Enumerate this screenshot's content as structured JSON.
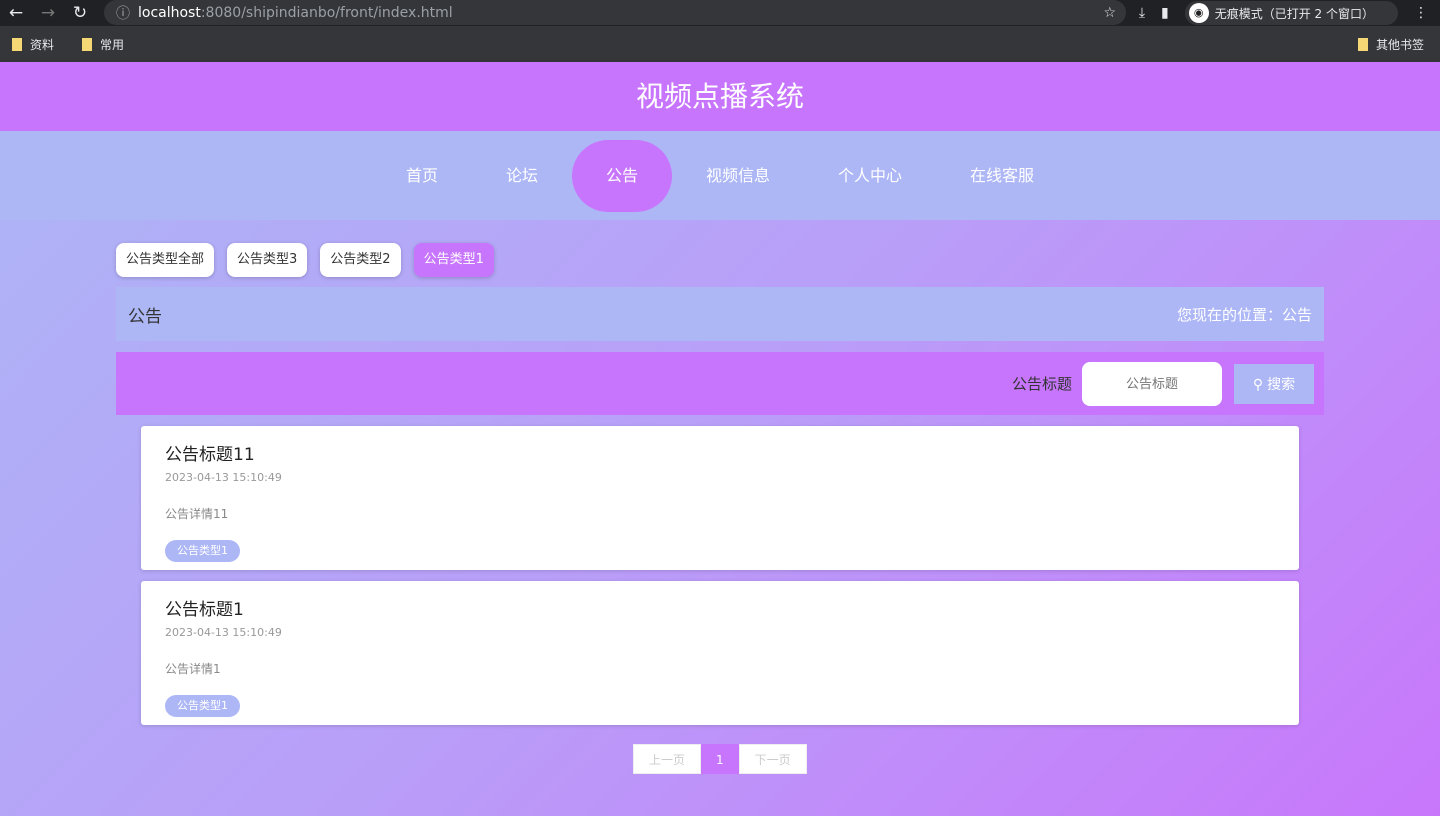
{
  "browser": {
    "url_host": "localhost",
    "url_path": ":8080/shipindianbo/front/index.html",
    "incognito": "无痕模式（已打开 2 个窗口）",
    "bookmarks": [
      "资料",
      "常用"
    ],
    "other_bookmarks": "其他书签"
  },
  "header": {
    "title": "视频点播系统"
  },
  "nav": [
    "首页",
    "论坛",
    "公告",
    "视频信息",
    "个人中心",
    "在线客服"
  ],
  "types": [
    "公告类型全部",
    "公告类型3",
    "公告类型2",
    "公告类型1"
  ],
  "breadcrumb": {
    "title": "公告",
    "position": "您现在的位置：公告"
  },
  "search": {
    "label": "公告标题",
    "placeholder": "公告标题",
    "button": "搜索"
  },
  "items": [
    {
      "title": "公告标题11",
      "time": "2023-04-13 15:10:49",
      "detail": "公告详情11",
      "tag": "公告类型1"
    },
    {
      "title": "公告标题1",
      "time": "2023-04-13 15:10:49",
      "detail": "公告详情1",
      "tag": "公告类型1"
    }
  ],
  "pager": {
    "prev": "上一页",
    "page": "1",
    "next": "下一页"
  }
}
